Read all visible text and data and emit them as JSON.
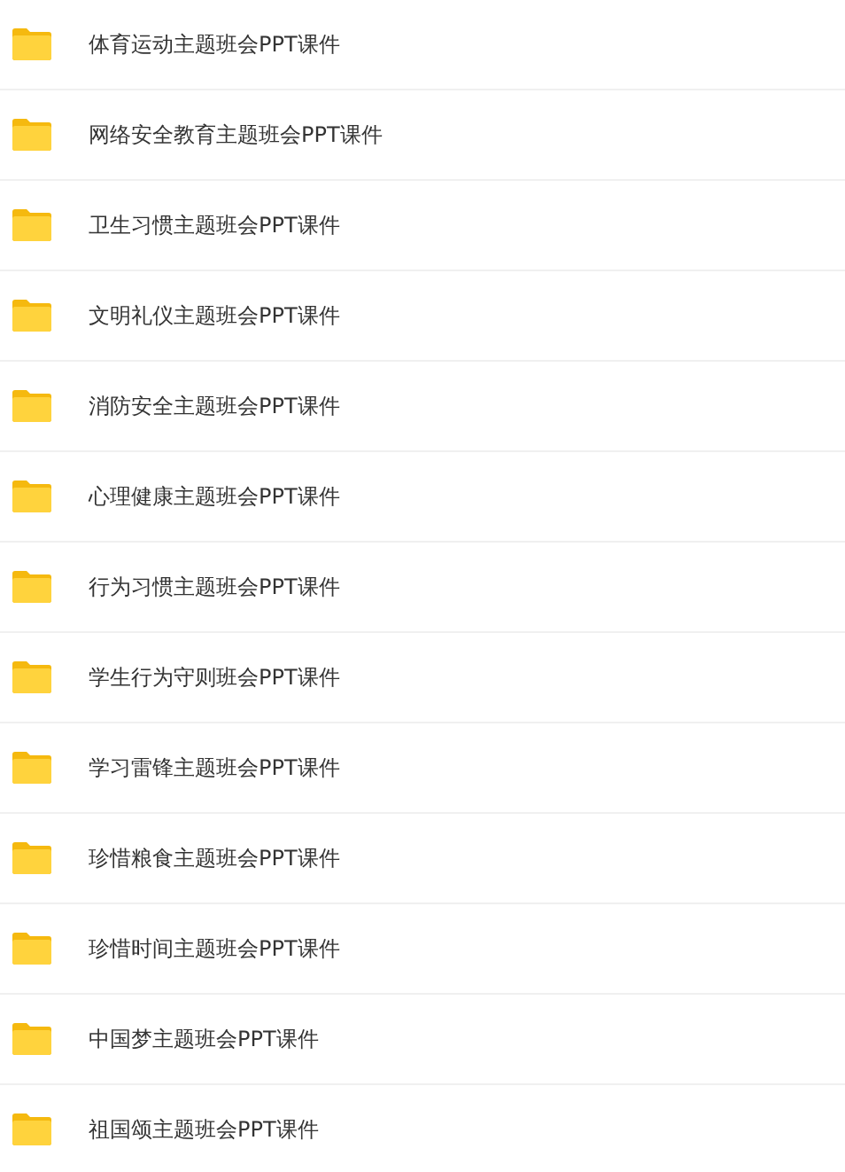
{
  "folders": [
    {
      "name": "体育运动主题班会PPT课件"
    },
    {
      "name": "网络安全教育主题班会PPT课件"
    },
    {
      "name": "卫生习惯主题班会PPT课件"
    },
    {
      "name": "文明礼仪主题班会PPT课件"
    },
    {
      "name": "消防安全主题班会PPT课件"
    },
    {
      "name": "心理健康主题班会PPT课件"
    },
    {
      "name": "行为习惯主题班会PPT课件"
    },
    {
      "name": "学生行为守则班会PPT课件"
    },
    {
      "name": "学习雷锋主题班会PPT课件"
    },
    {
      "name": "珍惜粮食主题班会PPT课件"
    },
    {
      "name": "珍惜时间主题班会PPT课件"
    },
    {
      "name": "中国梦主题班会PPT课件"
    },
    {
      "name": "祖国颂主题班会PPT课件"
    }
  ]
}
